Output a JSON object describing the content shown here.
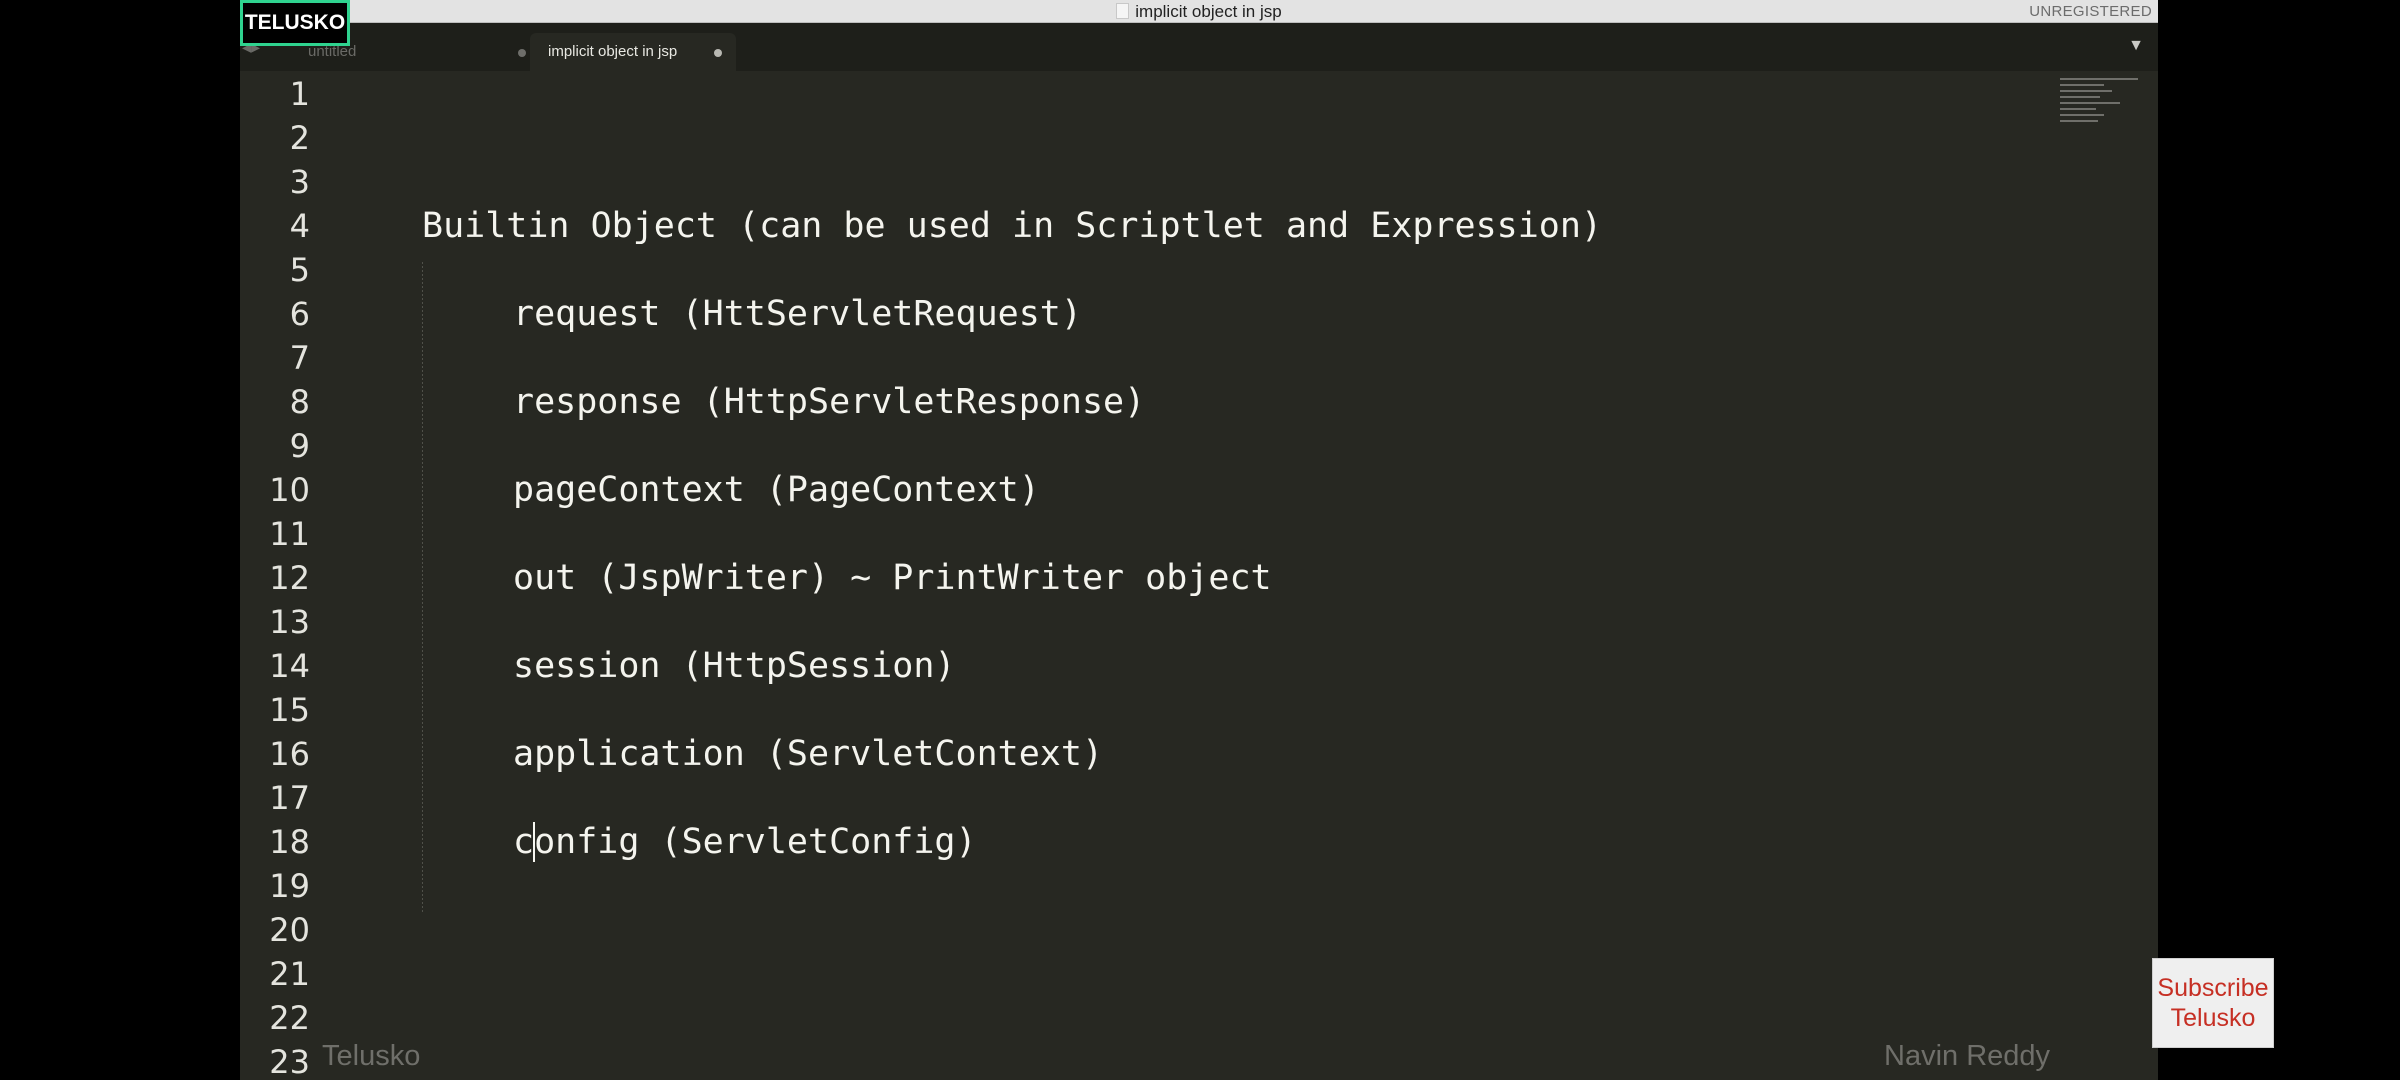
{
  "window": {
    "title": "implicit object in jsp",
    "registration": "UNREGISTERED"
  },
  "tabs": [
    {
      "label": "untitled",
      "active": false
    },
    {
      "label": "implicit object in jsp",
      "active": true
    }
  ],
  "logo": {
    "text": "TELUSKO"
  },
  "editor": {
    "line_numbers": [
      "1",
      "2",
      "3",
      "4",
      "5",
      "6",
      "7",
      "8",
      "9",
      "10",
      "11",
      "12",
      "13",
      "14",
      "15",
      "16",
      "17",
      "18",
      "19",
      "20",
      "21",
      "22",
      "23"
    ],
    "lines": [
      {
        "num": "4",
        "text": "Builtin Object (can be used in Scriptlet and Expression)"
      },
      {
        "num": "6",
        "text": "request (HttServletRequest)"
      },
      {
        "num": "8",
        "text": "response (HttpServletResponse)"
      },
      {
        "num": "10",
        "text": "pageContext (PageContext)"
      },
      {
        "num": "12",
        "text": "out (JspWriter) ~ PrintWriter object"
      },
      {
        "num": "14",
        "text": "session (HttpSession)"
      },
      {
        "num": "16",
        "text": "application (ServletContext)"
      },
      {
        "num": "18",
        "text": "config (ServletConfig)"
      }
    ],
    "current_line": "18"
  },
  "watermarks": {
    "left": "Telusko",
    "right": "Navin Reddy"
  },
  "subscribe": {
    "line1": "Subscribe",
    "line2": "Telusko"
  },
  "colors": {
    "editor_bg": "#272822",
    "text": "#f4f4ee",
    "logo_border": "#2fd38f",
    "subscribe_text": "#c62f24"
  }
}
